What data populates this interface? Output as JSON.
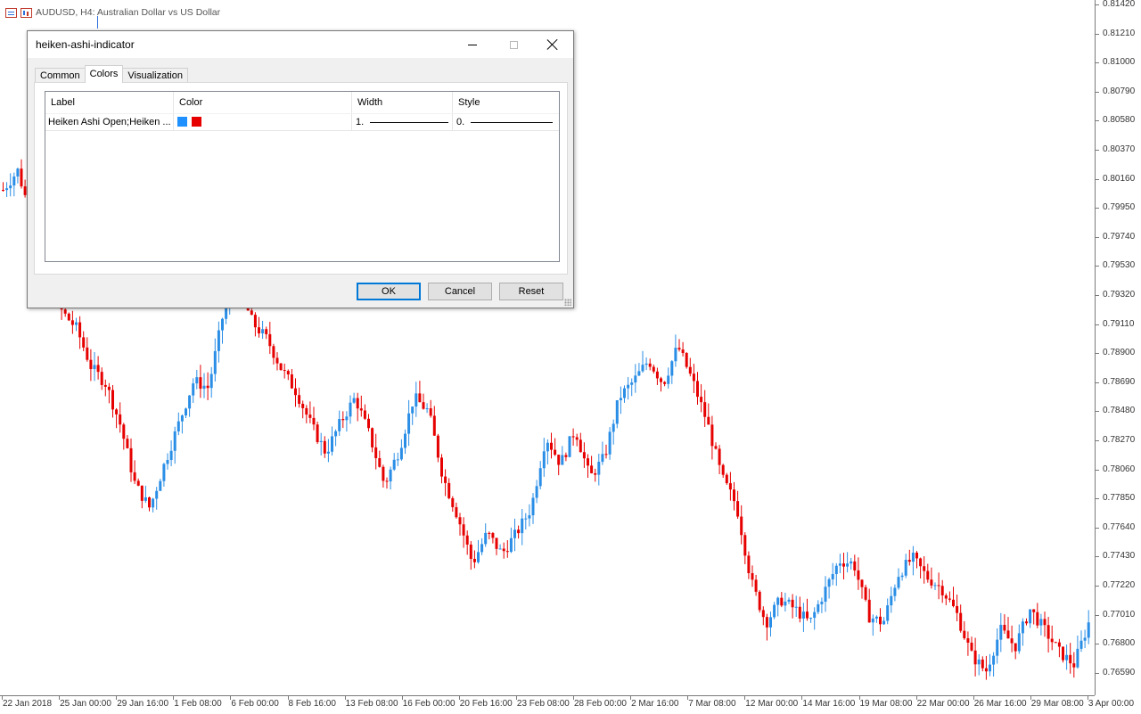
{
  "chart": {
    "symbol_title": "AUDUSD, H4:  Australian Dollar vs US Dollar",
    "bull_color": "#2a8ee6",
    "bear_color": "#e60000",
    "price_labels": [
      "0.81420",
      "0.81210",
      "0.81000",
      "0.80790",
      "0.80580",
      "0.80370",
      "0.80160",
      "0.79950",
      "0.79740",
      "0.79530",
      "0.79320",
      "0.79110",
      "0.78900",
      "0.78690",
      "0.78480",
      "0.78270",
      "0.78060",
      "0.77850",
      "0.77640",
      "0.77430",
      "0.77220",
      "0.77010",
      "0.76800",
      "0.76590"
    ],
    "time_labels": [
      "22 Jan 2018",
      "25 Jan 00:00",
      "29 Jan 16:00",
      "1 Feb 08:00",
      "6 Feb 00:00",
      "8 Feb 16:00",
      "13 Feb 08:00",
      "16 Feb 00:00",
      "20 Feb 16:00",
      "23 Feb 08:00",
      "28 Feb 00:00",
      "2 Mar 16:00",
      "7 Mar 08:00",
      "12 Mar 00:00",
      "14 Mar 16:00",
      "19 Mar 08:00",
      "22 Mar 00:00",
      "26 Mar 16:00",
      "29 Mar 08:00",
      "3 Apr 00:00"
    ],
    "price_path": [
      0.8008,
      0.8022,
      0.7985,
      0.797,
      0.792,
      0.7908,
      0.788,
      0.7868,
      0.7838,
      0.7795,
      0.7778,
      0.781,
      0.784,
      0.787,
      0.7865,
      0.7918,
      0.794,
      0.7912,
      0.79,
      0.7878,
      0.7862,
      0.7838,
      0.7818,
      0.784,
      0.7858,
      0.783,
      0.7795,
      0.782,
      0.7858,
      0.7848,
      0.78,
      0.7772,
      0.7738,
      0.776,
      0.7745,
      0.776,
      0.7778,
      0.783,
      0.781,
      0.7835,
      0.78,
      0.7815,
      0.7858,
      0.787,
      0.7885,
      0.7868,
      0.7895,
      0.787,
      0.784,
      0.78,
      0.778,
      0.7725,
      0.7695,
      0.7712,
      0.7705,
      0.7695,
      0.7718,
      0.774,
      0.7738,
      0.77,
      0.7695,
      0.773,
      0.7742,
      0.7728,
      0.772,
      0.7702,
      0.7672,
      0.766,
      0.769,
      0.7678,
      0.7705,
      0.769,
      0.7674,
      0.7665,
      0.7695
    ]
  },
  "dialog": {
    "title": "heiken-ashi-indicator",
    "tabs": [
      {
        "label": "Common",
        "active": false
      },
      {
        "label": "Colors",
        "active": true
      },
      {
        "label": "Visualization",
        "active": false
      }
    ],
    "grid": {
      "headers": {
        "label": "Label",
        "color": "Color",
        "width": "Width",
        "style": "Style"
      },
      "rows": [
        {
          "label": "Heiken Ashi Open;Heiken ...",
          "color1": "#1e90ff",
          "color2": "#e60000",
          "width": "1.",
          "style": "0."
        }
      ]
    },
    "buttons": {
      "ok": "OK",
      "cancel": "Cancel",
      "reset": "Reset"
    }
  }
}
